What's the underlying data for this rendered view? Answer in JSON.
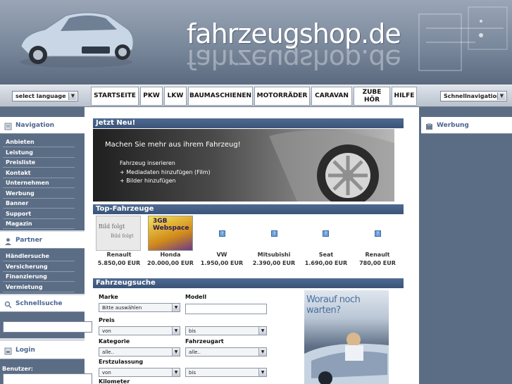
{
  "header": {
    "logo": "fahrzeugshop.de"
  },
  "navbar": {
    "language_select": "select language",
    "quicknav_select": "Schnellnavigation",
    "items": [
      "STARTSEITE",
      "PKW",
      "LKW",
      "BAUMASCHIENEN",
      "MOTORRÄDER",
      "CARAVAN",
      "ZUBEHÖR",
      "HILFE"
    ]
  },
  "left": {
    "navigation_title": "Navigation",
    "nav_items": [
      "Anbieten",
      "Leistung",
      "Preisliste",
      "Kontakt",
      "Unternehmen",
      "Werbung",
      "Banner",
      "Support",
      "Magazin"
    ],
    "partner_title": "Partner",
    "partner_items": [
      "Händlersuche",
      "Versicherung",
      "Finanzierung",
      "Vermietung"
    ],
    "quicksearch_title": "Schnellsuche",
    "login_title": "Login",
    "user_label": "Benutzer:"
  },
  "right": {
    "werbung_title": "Werbung"
  },
  "main": {
    "new_title": "Jetzt Neu!",
    "banner": {
      "headline": "Machen Sie mehr aus ihrem Fahrzeug!",
      "line1": "Fahrzeug inserieren",
      "line2": "+ Mediadaten hinzufügen (Film)",
      "line3": "+ Bilder hinzufügen"
    },
    "top_title": "Top-Fahrzeuge",
    "vehicles": [
      {
        "brand": "Renault",
        "price": "5.850,00 EUR",
        "thumb": "Bild folgt"
      },
      {
        "brand": "Honda",
        "price": "20.000,00 EUR",
        "thumb": "3GB Webspace"
      },
      {
        "brand": "VW",
        "price": "1.950,00 EUR"
      },
      {
        "brand": "Mitsubishi",
        "price": "2.390,00 EUR"
      },
      {
        "brand": "Seat",
        "price": "1.690,00 EUR"
      },
      {
        "brand": "Renault",
        "price": "780,00 EUR"
      }
    ],
    "search_title": "Fahrzeugsuche",
    "search": {
      "marke_label": "Marke",
      "marke_value": "Bitte auswählen",
      "modell_label": "Modell",
      "preis_label": "Preis",
      "preis_von": "von",
      "preis_bis": "bis",
      "kategorie_label": "Kategorie",
      "kategorie_value": "alle..",
      "fahrzeugart_label": "Fahrzeugart",
      "fahrzeugart_value": "alle..",
      "erstzulassung_label": "Erstzulassung",
      "ez_von": "von",
      "ez_bis": "bis",
      "kilometer_label": "Kilometer"
    },
    "ad_text": "Worauf noch warten?"
  }
}
